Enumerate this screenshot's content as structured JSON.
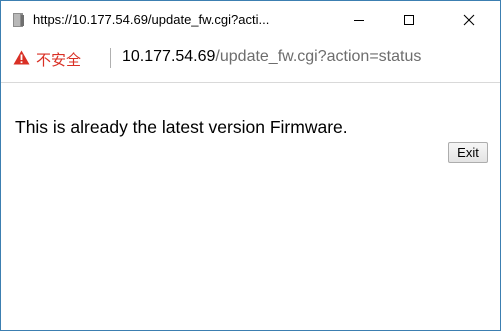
{
  "window": {
    "title": "https://10.177.54.69/update_fw.cgi?acti...",
    "minimize_glyph": "—",
    "maximize_glyph": "☐",
    "close_glyph": "✕"
  },
  "addressbar": {
    "security_label": "不安全",
    "url_host": "10.177.54.69",
    "url_path": "/update_fw.cgi?action=status",
    "warning_icon": "warning-triangle-icon"
  },
  "content": {
    "message": "This is already the latest version Firmware.",
    "exit_label": "Exit"
  },
  "colors": {
    "insecure_red": "#d93025",
    "url_path_gray": "#6d6d6d",
    "window_border": "#3c7fb1"
  }
}
